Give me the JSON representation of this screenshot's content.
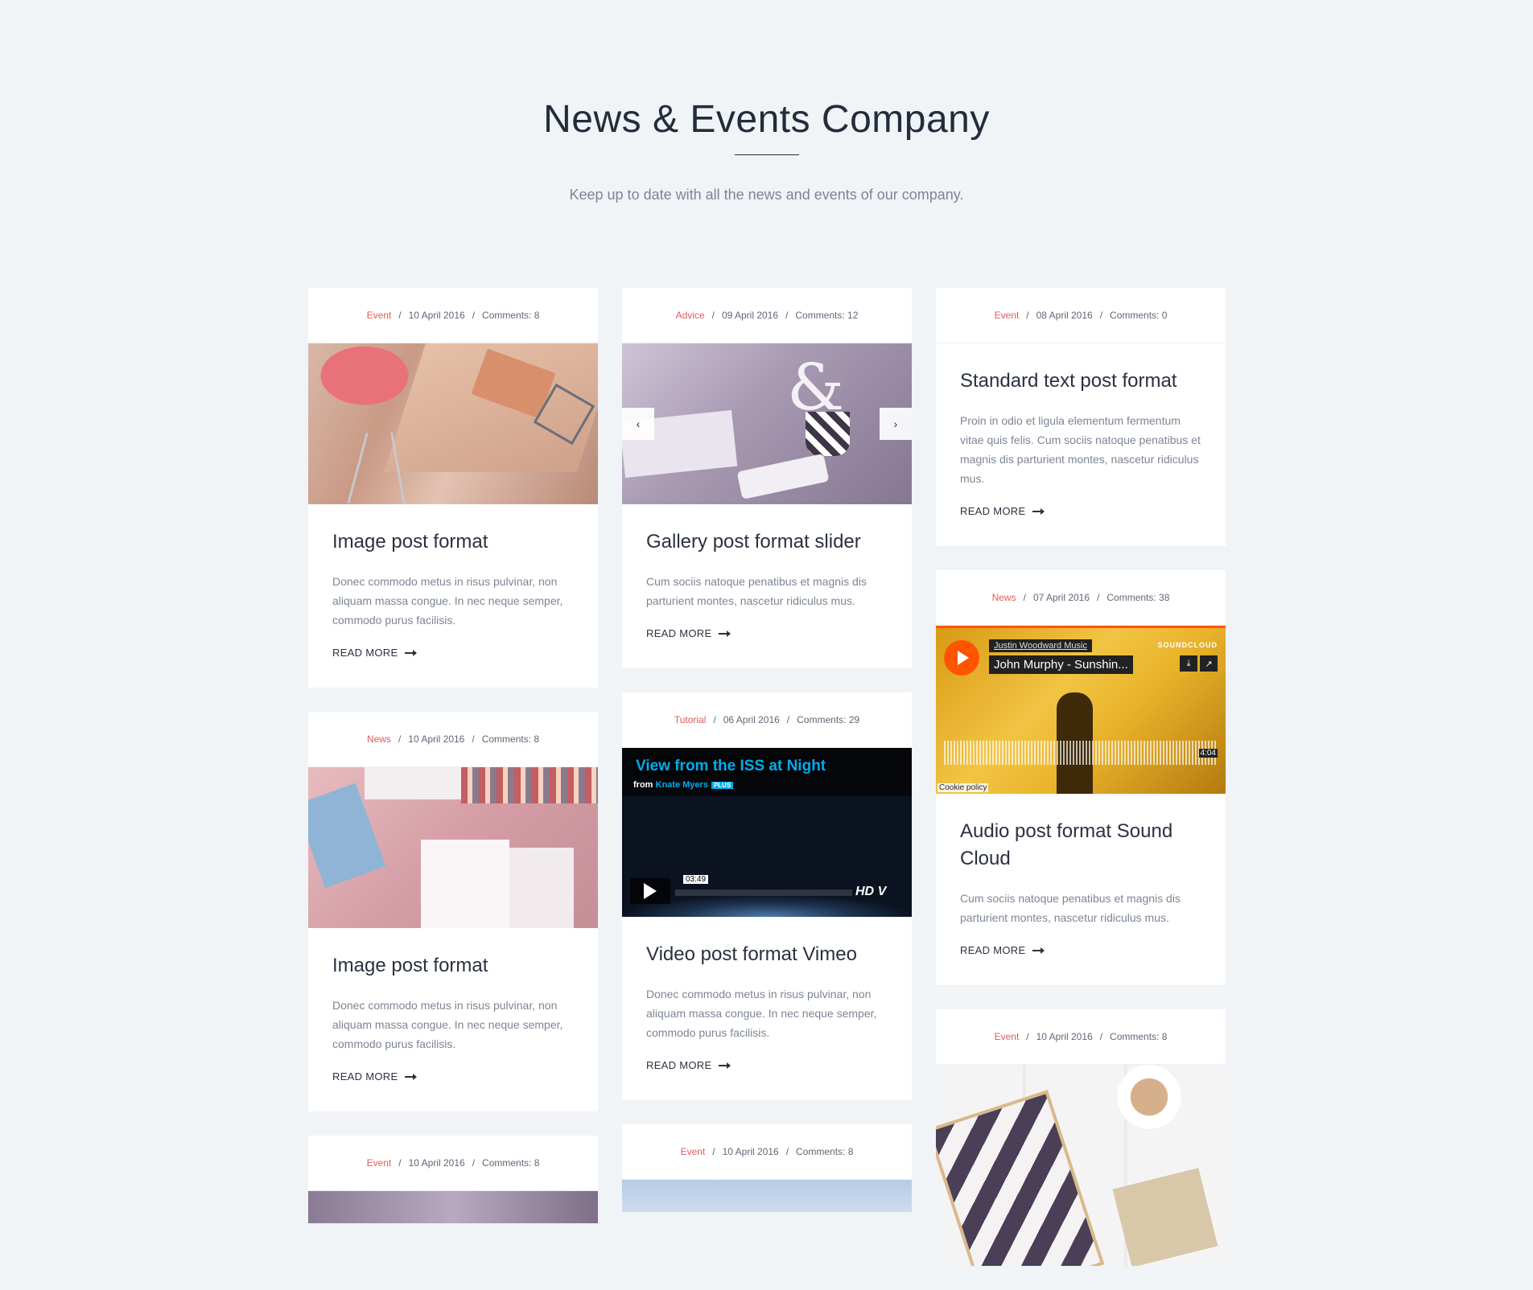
{
  "header": {
    "title": "News & Events Company",
    "subtitle": "Keep up to date with all the news and events of our company."
  },
  "read_more_label": "READ MORE",
  "colors": {
    "category": "#e15b5b",
    "background": "#f1f4f7",
    "heading": "#242c3b"
  },
  "columns": [
    [
      {
        "category": "Event",
        "date": "10 April 2016",
        "comments": "Comments: 8",
        "title": "Image post format",
        "excerpt": "Donec commodo metus in risus pulvinar, non aliquam massa congue. In nec neque semper, commodo purus facilisis."
      },
      {
        "category": "News",
        "date": "10 April 2016",
        "comments": "Comments: 8",
        "title": "Image post format",
        "excerpt": "Donec commodo metus in risus pulvinar, non aliquam massa congue. In nec neque semper, commodo purus facilisis."
      },
      {
        "category": "Event",
        "date": "10 April 2016",
        "comments": "Comments: 8"
      }
    ],
    [
      {
        "category": "Advice",
        "date": "09 April 2016",
        "comments": "Comments: 12",
        "title": "Gallery post format slider",
        "excerpt": "Cum sociis natoque penatibus et magnis dis parturient montes, nascetur ridiculus mus."
      },
      {
        "category": "Tutorial",
        "date": "06 April 2016",
        "comments": "Comments: 29",
        "title": "Video post format Vimeo",
        "excerpt": "Donec commodo metus in risus pulvinar, non aliquam massa congue. In nec neque semper, commodo purus facilisis."
      },
      {
        "category": "Event",
        "date": "10 April 2016",
        "comments": "Comments: 8"
      }
    ],
    [
      {
        "category": "Event",
        "date": "08 April 2016",
        "comments": "Comments: 0",
        "title": "Standard text post format",
        "excerpt": "Proin in odio et ligula elementum fermentum vitae quis felis. Cum sociis natoque penatibus et magnis dis parturient montes, nascetur ridiculus mus."
      },
      {
        "category": "News",
        "date": "07 April 2016",
        "comments": "Comments: 38",
        "title": "Audio post format Sound Cloud",
        "excerpt": "Cum sociis natoque penatibus et magnis dis parturient montes, nascetur ridiculus mus."
      },
      {
        "category": "Event",
        "date": "10 April 2016",
        "comments": "Comments: 8"
      }
    ]
  ],
  "vimeo": {
    "title": "View from the ISS at Night",
    "from": "from",
    "author": "Knate Myers",
    "badge": "PLUS",
    "time": "03:49",
    "hd": "HD"
  },
  "soundcloud": {
    "artist": "Justin Woodward Music",
    "track": "John Murphy - Sunshin...",
    "brand": "SOUNDCLOUD",
    "duration": "4:04",
    "cookie": "Cookie policy"
  },
  "slider": {
    "prev": "‹",
    "next": "›"
  }
}
